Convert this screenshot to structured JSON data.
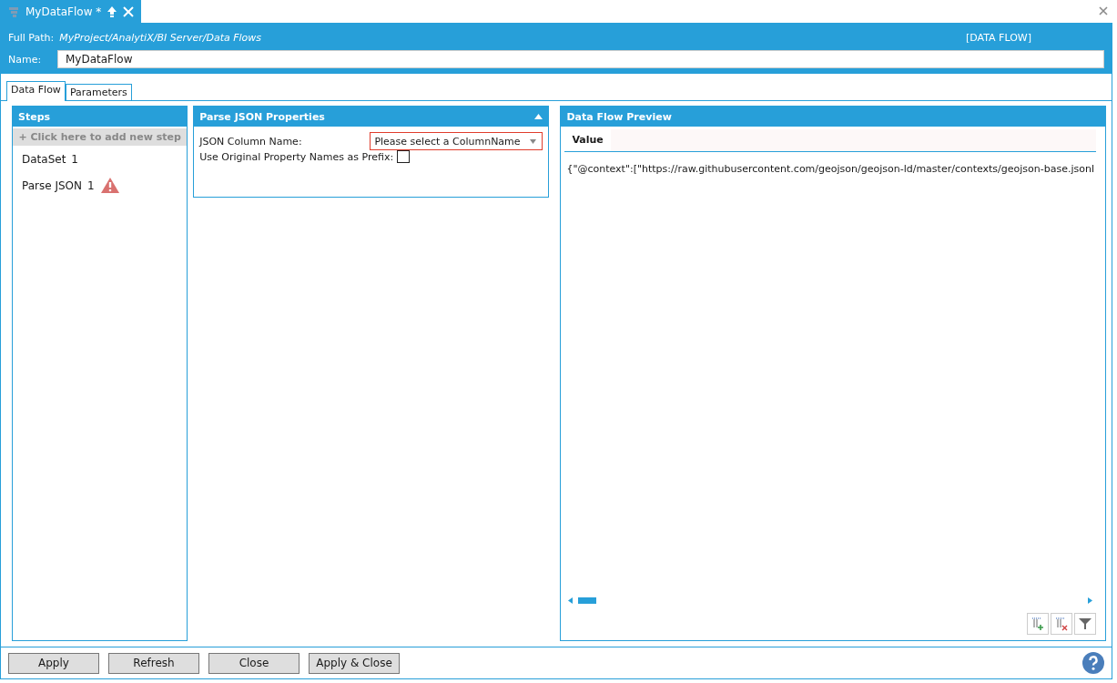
{
  "doc_tab": {
    "title": "MyDataFlow *"
  },
  "header": {
    "path_label": "Full Path:",
    "path": "MyProject/AnalytiX/BI Server/Data Flows",
    "type": "[DATA FLOW]",
    "name_label": "Name:",
    "name_value": "MyDataFlow"
  },
  "tabs": [
    {
      "label": "Data Flow",
      "selected": true
    },
    {
      "label": "Parameters",
      "selected": false
    }
  ],
  "steps": {
    "title": "Steps",
    "add_label": "+  Click here to add new step",
    "items": [
      {
        "name": "DataSet",
        "count": "1",
        "warning": false
      },
      {
        "name": "Parse JSON",
        "count": "1",
        "warning": true
      }
    ]
  },
  "properties": {
    "title": "Parse JSON Properties",
    "column_label": "JSON Column Name:",
    "column_placeholder": "Please select a ColumnName",
    "invalid": true,
    "prefix_label": "Use Original Property Names as Prefix:",
    "prefix_checked": false
  },
  "preview": {
    "title": "Data Flow Preview",
    "column": "Value",
    "rows": [
      "{\"@context\":[\"https://raw.githubusercontent.com/geojson/geojson-ld/master/contexts/geojson-base.jsonl"
    ]
  },
  "buttons": [
    "Apply",
    "Refresh",
    "Close",
    "Apply & Close"
  ]
}
